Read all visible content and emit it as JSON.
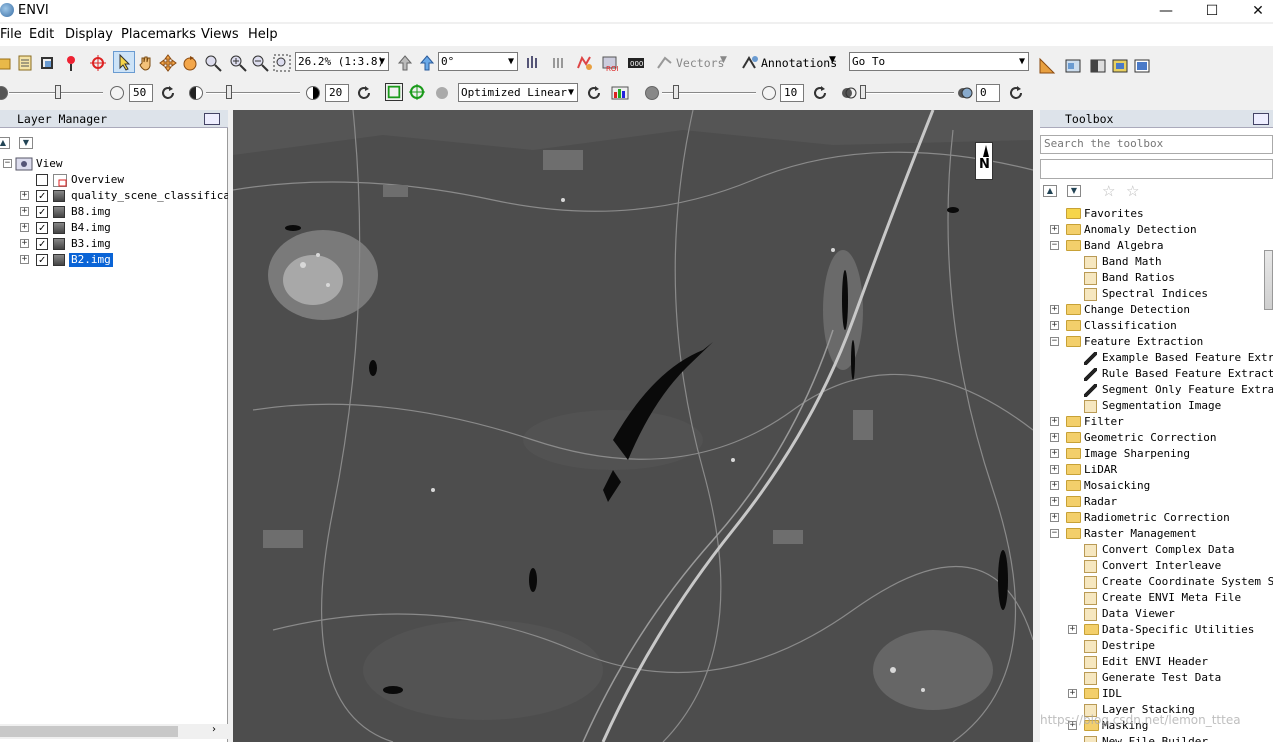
{
  "window": {
    "title": "ENVI",
    "min": "—",
    "max": "☐",
    "close": "✕"
  },
  "menu": [
    "File",
    "Edit",
    "Display",
    "Placemarks",
    "Views",
    "Help"
  ],
  "toolbar1": {
    "zoom_value": "26.2% (1:3.8)",
    "rotation_value": "0°",
    "vectors_label": "Vectors",
    "annotations_label": "Annotations",
    "goto_value": "Go To"
  },
  "toolbar2": {
    "brightness_value": "50",
    "contrast_value": "20",
    "stretch_value": "Optimized Linear",
    "sharpen_value": "10",
    "transparency_value": "0"
  },
  "layer_manager": {
    "title": "Layer Manager",
    "root": "View",
    "items": [
      "Overview",
      "quality_scene_classification",
      "B8.img",
      "B4.img",
      "B3.img",
      "B2.img"
    ],
    "selected": "B2.img"
  },
  "north_arrow": "N",
  "toolbox": {
    "title": "Toolbox",
    "search_placeholder": "Search the toolbox",
    "items": [
      {
        "label": "Favorites",
        "level": 0,
        "kind": "fav"
      },
      {
        "label": "Anomaly Detection",
        "level": 0,
        "kind": "folder",
        "exp": "+"
      },
      {
        "label": "Band Algebra",
        "level": 0,
        "kind": "folder",
        "exp": "−"
      },
      {
        "label": "Band Math",
        "level": 1,
        "kind": "tool"
      },
      {
        "label": "Band Ratios",
        "level": 1,
        "kind": "tool"
      },
      {
        "label": "Spectral Indices",
        "level": 1,
        "kind": "tool"
      },
      {
        "label": "Change Detection",
        "level": 0,
        "kind": "folder",
        "exp": "+"
      },
      {
        "label": "Classification",
        "level": 0,
        "kind": "folder",
        "exp": "+"
      },
      {
        "label": "Feature Extraction",
        "level": 0,
        "kind": "folder",
        "exp": "−"
      },
      {
        "label": "Example Based Feature Extraction Workflow",
        "level": 1,
        "kind": "wand"
      },
      {
        "label": "Rule Based Feature Extraction Workflow",
        "level": 1,
        "kind": "wand"
      },
      {
        "label": "Segment Only Feature Extraction Workflow",
        "level": 1,
        "kind": "wand"
      },
      {
        "label": "Segmentation Image",
        "level": 1,
        "kind": "tool"
      },
      {
        "label": "Filter",
        "level": 0,
        "kind": "folder",
        "exp": "+"
      },
      {
        "label": "Geometric Correction",
        "level": 0,
        "kind": "folder",
        "exp": "+"
      },
      {
        "label": "Image Sharpening",
        "level": 0,
        "kind": "folder",
        "exp": "+"
      },
      {
        "label": "LiDAR",
        "level": 0,
        "kind": "folder",
        "exp": "+"
      },
      {
        "label": "Mosaicking",
        "level": 0,
        "kind": "folder",
        "exp": "+"
      },
      {
        "label": "Radar",
        "level": 0,
        "kind": "folder",
        "exp": "+"
      },
      {
        "label": "Radiometric Correction",
        "level": 0,
        "kind": "folder",
        "exp": "+"
      },
      {
        "label": "Raster Management",
        "level": 0,
        "kind": "folder",
        "exp": "−"
      },
      {
        "label": "Convert Complex Data",
        "level": 1,
        "kind": "tool"
      },
      {
        "label": "Convert Interleave",
        "level": 1,
        "kind": "tool"
      },
      {
        "label": "Create Coordinate System String",
        "level": 1,
        "kind": "tool"
      },
      {
        "label": "Create ENVI Meta File",
        "level": 1,
        "kind": "tool"
      },
      {
        "label": "Data Viewer",
        "level": 1,
        "kind": "tool"
      },
      {
        "label": "Data-Specific Utilities",
        "level": 1,
        "kind": "folder",
        "exp": "+"
      },
      {
        "label": "Destripe",
        "level": 1,
        "kind": "tool"
      },
      {
        "label": "Edit ENVI Header",
        "level": 1,
        "kind": "tool"
      },
      {
        "label": "Generate Test Data",
        "level": 1,
        "kind": "tool"
      },
      {
        "label": "IDL",
        "level": 1,
        "kind": "folder",
        "exp": "+"
      },
      {
        "label": "Layer Stacking",
        "level": 1,
        "kind": "tool"
      },
      {
        "label": "Masking",
        "level": 1,
        "kind": "folder",
        "exp": "+"
      },
      {
        "label": "New File Builder",
        "level": 1,
        "kind": "tool"
      }
    ]
  },
  "watermark": "https://blog.csdn.net/lemon_tttea"
}
